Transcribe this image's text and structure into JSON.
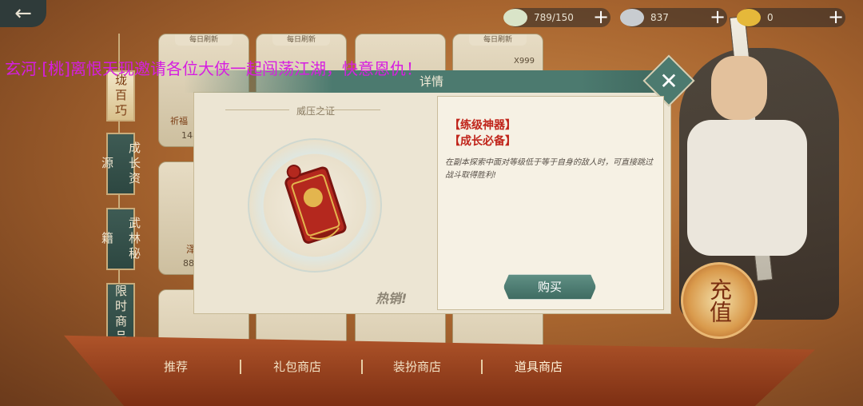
{
  "top_bar": {
    "resources": [
      {
        "icon": "rice-bun-icon",
        "value": "789/150",
        "color": "#d9e4c8"
      },
      {
        "icon": "silver-ingot-icon",
        "value": "837",
        "color": "#c8ccd0"
      },
      {
        "icon": "gold-ingot-icon",
        "value": "0",
        "color": "#e5b83a"
      }
    ]
  },
  "side_tabs": [
    {
      "label": "珑百巧",
      "active": true
    },
    {
      "label": "成长资源",
      "active": false
    },
    {
      "label": "武林秘籍",
      "active": false
    },
    {
      "label": "限时商品",
      "active": false
    }
  ],
  "cards": {
    "badge": "每日刷新",
    "first_name": "祈福",
    "first_price": "148",
    "second_price": "88",
    "second_partial": "泽",
    "count": "X999"
  },
  "marquee": "玄河·[桃]离恨天现邀请各位大侠一起闯荡江湖，快意恩仇！",
  "dialog": {
    "title": "详情",
    "item_name": "威压之证",
    "hot_label": "热销!",
    "tags": [
      "【练级神器】",
      "【成长必备】"
    ],
    "description": "在副本探索中面对等级低于等于自身的敌人时，可直接跳过战斗取得胜利!",
    "buy_label": "购买"
  },
  "bottom_tabs": [
    "推荐",
    "礼包商店",
    "装扮商店",
    "道具商店"
  ],
  "recharge_label": "充值"
}
